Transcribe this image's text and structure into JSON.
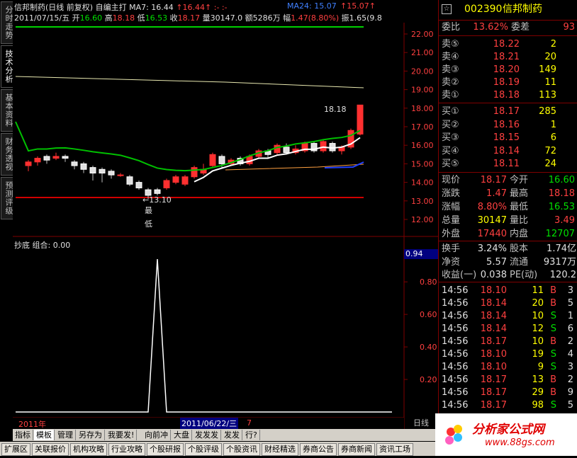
{
  "left_tabs": [
    "分时走势",
    "技术分析",
    "基本资料",
    "财务透视",
    "预测评级"
  ],
  "header": {
    "stock_name": "信邦制药",
    "mode": "(日线 前复权)",
    "indicator": "自编主打",
    "ma7_label": "MA7: 16.44",
    "ma7_suffix": "↑16.44↑ :- :-",
    "ma24_label": "MA24: 15.07",
    "ma24_suffix": "↑15.07↑",
    "date": "2011/07/15/五",
    "open_label": "开",
    "open_value": "16.60",
    "high_label": "高",
    "high_value": "18.18",
    "low_label": "低",
    "low_value": "16.53",
    "close_label": "收",
    "close_value": "18.17",
    "vol_label": "量",
    "vol_value": "30147.0",
    "amt_label": "额",
    "amt_value": "5286万",
    "change_label": "幅",
    "change_value": "1.47(8.80%)",
    "amp_label": "振",
    "amp_value": "1.65(9.8"
  },
  "main_axis": [
    "22.00",
    "21.00",
    "20.00",
    "19.00",
    "18.00",
    "17.00",
    "16.00",
    "15.00",
    "14.00",
    "13.00",
    "12.00"
  ],
  "annotations": {
    "high_mark": "18.18",
    "low_mark": "←13.10",
    "low_text_1": "最",
    "low_text_2": "低"
  },
  "sub_panel": {
    "title": "抄底  组合: 0.00",
    "current_value": "0.94",
    "axis": [
      "0.80",
      "0.60",
      "0.40",
      "0.20"
    ]
  },
  "bottom_axis": {
    "year": "2011年",
    "cursor_date": "2011/06/22/三",
    "month": "7",
    "period": "日线"
  },
  "toolbar1": [
    "指标",
    "模板",
    "管理",
    "另存为",
    "我要发!",
    "向前冲",
    "大盘",
    "发发发",
    "发发",
    "行?"
  ],
  "toolbar1_selected": "模板",
  "toolbar2": [
    "扩展区",
    "关联报价",
    "机构攻略",
    "行业攻略",
    "个股研报",
    "个股评级",
    "个股资讯",
    "财经精选",
    "券商公告",
    "券商新闻",
    "资讯工场"
  ],
  "right_panel": {
    "code": "002390",
    "name": "信邦制药",
    "weibi_label": "委比",
    "weibi_value": "13.62%",
    "weicha_label": "委差",
    "weicha_value": "93",
    "asks": [
      {
        "label": "卖⑤",
        "price": "18.22",
        "vol": "2"
      },
      {
        "label": "卖④",
        "price": "18.21",
        "vol": "20"
      },
      {
        "label": "卖③",
        "price": "18.20",
        "vol": "149"
      },
      {
        "label": "卖②",
        "price": "18.19",
        "vol": "11"
      },
      {
        "label": "卖①",
        "price": "18.18",
        "vol": "113"
      }
    ],
    "bids": [
      {
        "label": "买①",
        "price": "18.17",
        "vol": "285"
      },
      {
        "label": "买②",
        "price": "18.16",
        "vol": "1"
      },
      {
        "label": "买③",
        "price": "18.15",
        "vol": "6"
      },
      {
        "label": "买④",
        "price": "18.14",
        "vol": "72"
      },
      {
        "label": "买⑤",
        "price": "18.11",
        "vol": "24"
      }
    ],
    "quote": [
      {
        "l1": "现价",
        "v1": "18.17",
        "c1": "red",
        "l2": "今开",
        "v2": "16.60",
        "c2": "grn"
      },
      {
        "l1": "涨跌",
        "v1": "1.47",
        "c1": "red",
        "l2": "最高",
        "v2": "18.18",
        "c2": "red"
      },
      {
        "l1": "涨幅",
        "v1": "8.80%",
        "c1": "red",
        "l2": "最低",
        "v2": "16.53",
        "c2": "grn"
      },
      {
        "l1": "总量",
        "v1": "30147",
        "c1": "ylw",
        "l2": "量比",
        "v2": "3.49",
        "c2": "red"
      },
      {
        "l1": "外盘",
        "v1": "17440",
        "c1": "red",
        "l2": "内盘",
        "v2": "12707",
        "c2": "grn"
      }
    ],
    "fundamentals": [
      {
        "l1": "换手",
        "v1": "3.24%",
        "l2": "股本",
        "v2": "1.74亿"
      },
      {
        "l1": "净资",
        "v1": "5.57",
        "l2": "流通",
        "v2": "9317万"
      },
      {
        "l1": "收益(一)",
        "v1": "0.038",
        "l2": "PE(动)",
        "v2": "120.2"
      }
    ],
    "ticks": [
      {
        "time": "14:56",
        "price": "18.10",
        "vol": "11",
        "side": "B",
        "n": "3"
      },
      {
        "time": "14:56",
        "price": "18.14",
        "vol": "20",
        "side": "B",
        "n": "5"
      },
      {
        "time": "14:56",
        "price": "18.14",
        "vol": "10",
        "side": "S",
        "n": "1"
      },
      {
        "time": "14:56",
        "price": "18.14",
        "vol": "12",
        "side": "S",
        "n": "6"
      },
      {
        "time": "14:56",
        "price": "18.17",
        "vol": "10",
        "side": "B",
        "n": "2"
      },
      {
        "time": "14:56",
        "price": "18.10",
        "vol": "19",
        "side": "S",
        "n": "4"
      },
      {
        "time": "14:56",
        "price": "18.10",
        "vol": "9",
        "side": "S",
        "n": "3"
      },
      {
        "time": "14:56",
        "price": "18.17",
        "vol": "13",
        "side": "B",
        "n": "2"
      },
      {
        "time": "14:56",
        "price": "18.17",
        "vol": "29",
        "side": "B",
        "n": "9"
      },
      {
        "time": "14:56",
        "price": "18.17",
        "vol": "98",
        "side": "S",
        "n": "5"
      },
      {
        "time": "14:57",
        "price": "18.17",
        "vol": "36",
        "side": "S",
        "n": "2"
      }
    ]
  },
  "logo": {
    "text": "分析家公式网",
    "url": "www.88gs.com"
  },
  "chart_data": {
    "type": "candlestick",
    "y_range": [
      11.5,
      22.5
    ],
    "candles": [
      {
        "o": 14.9,
        "c": 15.1,
        "h": 15.2,
        "l": 14.6
      },
      {
        "o": 15.1,
        "c": 15.3,
        "h": 15.4,
        "l": 14.9
      },
      {
        "o": 15.4,
        "c": 15.2,
        "h": 15.5,
        "l": 15.0
      },
      {
        "o": 15.3,
        "c": 15.4,
        "h": 15.6,
        "l": 15.2
      },
      {
        "o": 15.4,
        "c": 15.3,
        "h": 15.5,
        "l": 15.1
      },
      {
        "o": 15.1,
        "c": 14.9,
        "h": 15.2,
        "l": 14.7
      },
      {
        "o": 15.0,
        "c": 14.7,
        "h": 15.1,
        "l": 14.5
      },
      {
        "o": 14.8,
        "c": 14.5,
        "h": 14.9,
        "l": 14.1
      },
      {
        "o": 14.7,
        "c": 14.5,
        "h": 14.8,
        "l": 14.0
      },
      {
        "o": 14.6,
        "c": 14.4,
        "h": 14.7,
        "l": 14.2
      },
      {
        "o": 14.4,
        "c": 14.4,
        "h": 14.5,
        "l": 14.3
      },
      {
        "o": 14.3,
        "c": 13.9,
        "h": 14.4,
        "l": 13.8
      },
      {
        "o": 14.0,
        "c": 13.7,
        "h": 14.1,
        "l": 13.6
      },
      {
        "o": 13.6,
        "c": 13.3,
        "h": 13.7,
        "l": 13.1
      },
      {
        "o": 13.6,
        "c": 13.4,
        "h": 13.7,
        "l": 13.3
      },
      {
        "o": 13.7,
        "c": 14.1,
        "h": 14.2,
        "l": 13.6
      },
      {
        "o": 14.0,
        "c": 14.3,
        "h": 14.4,
        "l": 13.9
      },
      {
        "o": 13.9,
        "c": 14.3,
        "h": 14.4,
        "l": 13.8
      },
      {
        "o": 14.3,
        "c": 14.8,
        "h": 14.9,
        "l": 14.2
      },
      {
        "o": 14.5,
        "c": 14.7,
        "h": 15.0,
        "l": 14.4
      },
      {
        "o": 14.9,
        "c": 15.5,
        "h": 15.6,
        "l": 14.8
      },
      {
        "o": 15.4,
        "c": 15.0,
        "h": 15.5,
        "l": 14.8
      },
      {
        "o": 15.0,
        "c": 15.2,
        "h": 15.3,
        "l": 14.9
      },
      {
        "o": 15.3,
        "c": 15.0,
        "h": 15.4,
        "l": 14.9
      },
      {
        "o": 15.0,
        "c": 15.4,
        "h": 15.5,
        "l": 14.9
      },
      {
        "o": 15.4,
        "c": 15.7,
        "h": 15.8,
        "l": 15.3
      },
      {
        "o": 15.7,
        "c": 15.5,
        "h": 15.8,
        "l": 15.3
      },
      {
        "o": 15.6,
        "c": 16.0,
        "h": 16.1,
        "l": 15.5
      },
      {
        "o": 15.9,
        "c": 15.6,
        "h": 16.1,
        "l": 15.5
      },
      {
        "o": 15.6,
        "c": 15.8,
        "h": 16.0,
        "l": 15.5
      },
      {
        "o": 15.7,
        "c": 16.1,
        "h": 16.2,
        "l": 15.6
      },
      {
        "o": 16.1,
        "c": 15.7,
        "h": 16.2,
        "l": 15.6
      },
      {
        "o": 15.7,
        "c": 16.2,
        "h": 16.3,
        "l": 15.6
      },
      {
        "o": 16.1,
        "c": 15.7,
        "h": 16.2,
        "l": 15.6
      },
      {
        "o": 15.7,
        "c": 15.9,
        "h": 16.0,
        "l": 15.5
      },
      {
        "o": 15.9,
        "c": 16.8,
        "h": 16.9,
        "l": 15.8
      },
      {
        "o": 16.6,
        "c": 18.17,
        "h": 18.18,
        "l": 16.53
      }
    ],
    "ma_short_color": "#ffffff",
    "ma_long_color": "#00c000",
    "sub_series": [
      0,
      0,
      0,
      0,
      0,
      0,
      0,
      0,
      0,
      0,
      0,
      0,
      0,
      0,
      0.94,
      0,
      0,
      0,
      0,
      0,
      0,
      0,
      0,
      0,
      0,
      0,
      0,
      0,
      0,
      0,
      0,
      0,
      0,
      0,
      0,
      0,
      0
    ]
  }
}
